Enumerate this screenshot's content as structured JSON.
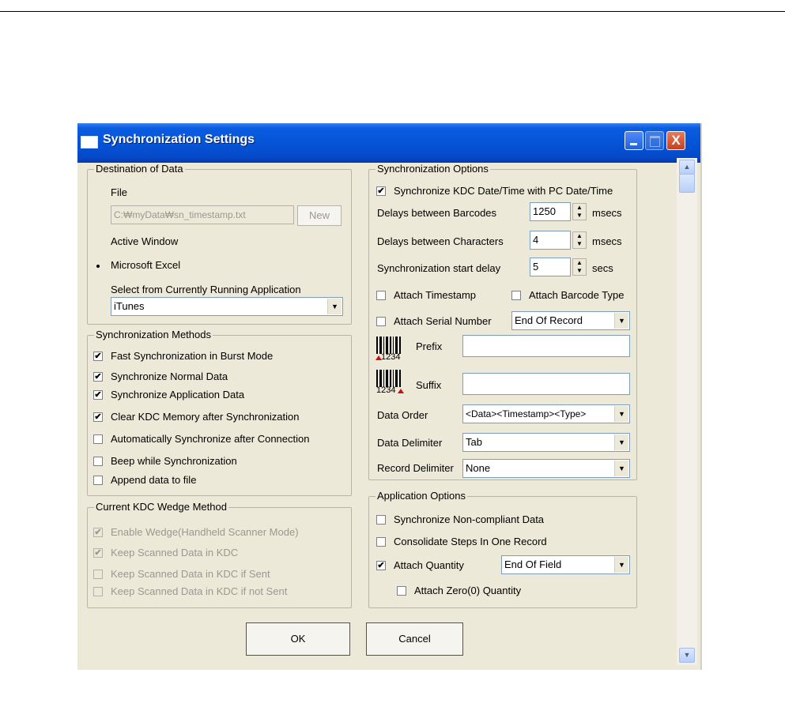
{
  "window": {
    "title": "Synchronization Settings",
    "close_glyph": "X"
  },
  "destination": {
    "legend": "Destination of Data",
    "file_label": "File",
    "file_path": "C:₩myData₩sn_timestamp.txt",
    "new_label": "New",
    "active_window_label": "Active Window",
    "excel_label": "Microsoft Excel",
    "running_app_label": "Select from Currently Running Application",
    "running_app_value": "iTunes",
    "selected": "Microsoft Excel"
  },
  "methods": {
    "legend": "Synchronization Methods",
    "items": [
      {
        "label": "Fast Synchronization in Burst Mode",
        "checked": true
      },
      {
        "label": "Synchronize Normal Data",
        "checked": true
      },
      {
        "label": "Synchronize Application Data",
        "checked": true
      },
      {
        "label": "Clear KDC Memory after Synchronization",
        "checked": true
      },
      {
        "label": "Automatically Synchronize after Connection",
        "checked": false
      },
      {
        "label": "Beep while Synchronization",
        "checked": false
      },
      {
        "label": "Append data to file",
        "checked": false
      }
    ]
  },
  "wedge": {
    "legend": "Current KDC Wedge Method",
    "items": [
      {
        "label": "Enable Wedge(Handheld Scanner Mode)",
        "checked": true
      },
      {
        "label": "Keep Scanned Data in KDC",
        "checked": true
      },
      {
        "label": "Keep Scanned Data in KDC if Sent",
        "checked": false
      },
      {
        "label": "Keep Scanned Data in KDC if not Sent",
        "checked": false
      }
    ]
  },
  "sync_options": {
    "legend": "Synchronization Options",
    "sync_datetime_label": "Synchronize KDC Date/Time with PC Date/Time",
    "delays_barcodes_label": "Delays between Barcodes",
    "delays_barcodes_value": "1250",
    "delays_barcodes_unit": "msecs",
    "delays_chars_label": "Delays between Characters",
    "delays_chars_value": "4",
    "delays_chars_unit": "msecs",
    "start_delay_label": "Synchronization start delay",
    "start_delay_value": "5",
    "start_delay_unit": "secs",
    "attach_timestamp_label": "Attach Timestamp",
    "attach_barcode_type_label": "Attach Barcode Type",
    "attach_serial_label": "Attach Serial Number",
    "serial_position_value": "End Of Record",
    "prefix_label": "Prefix",
    "prefix_value": "",
    "prefix_code": "1234",
    "suffix_label": "Suffix",
    "suffix_value": "",
    "suffix_code": "1234",
    "data_order_label": "Data Order",
    "data_order_value": "<Data><Timestamp><Type>",
    "data_delimiter_label": "Data Delimiter",
    "data_delimiter_value": "Tab",
    "record_delimiter_label": "Record Delimiter",
    "record_delimiter_value": "None"
  },
  "app_options": {
    "legend": "Application Options",
    "noncompliant_label": "Synchronize Non-compliant Data",
    "consolidate_label": "Consolidate Steps In One Record",
    "attach_quantity_label": "Attach Quantity",
    "quantity_position_value": "End Of Field",
    "attach_zero_label": "Attach Zero(0) Quantity"
  },
  "buttons": {
    "ok": "OK",
    "cancel": "Cancel"
  },
  "icons": {
    "checkmark": "✔",
    "dropdown": "▼",
    "spin_up": "▲",
    "spin_down": "▼",
    "scroll_up": "▲",
    "scroll_down": "▼"
  }
}
